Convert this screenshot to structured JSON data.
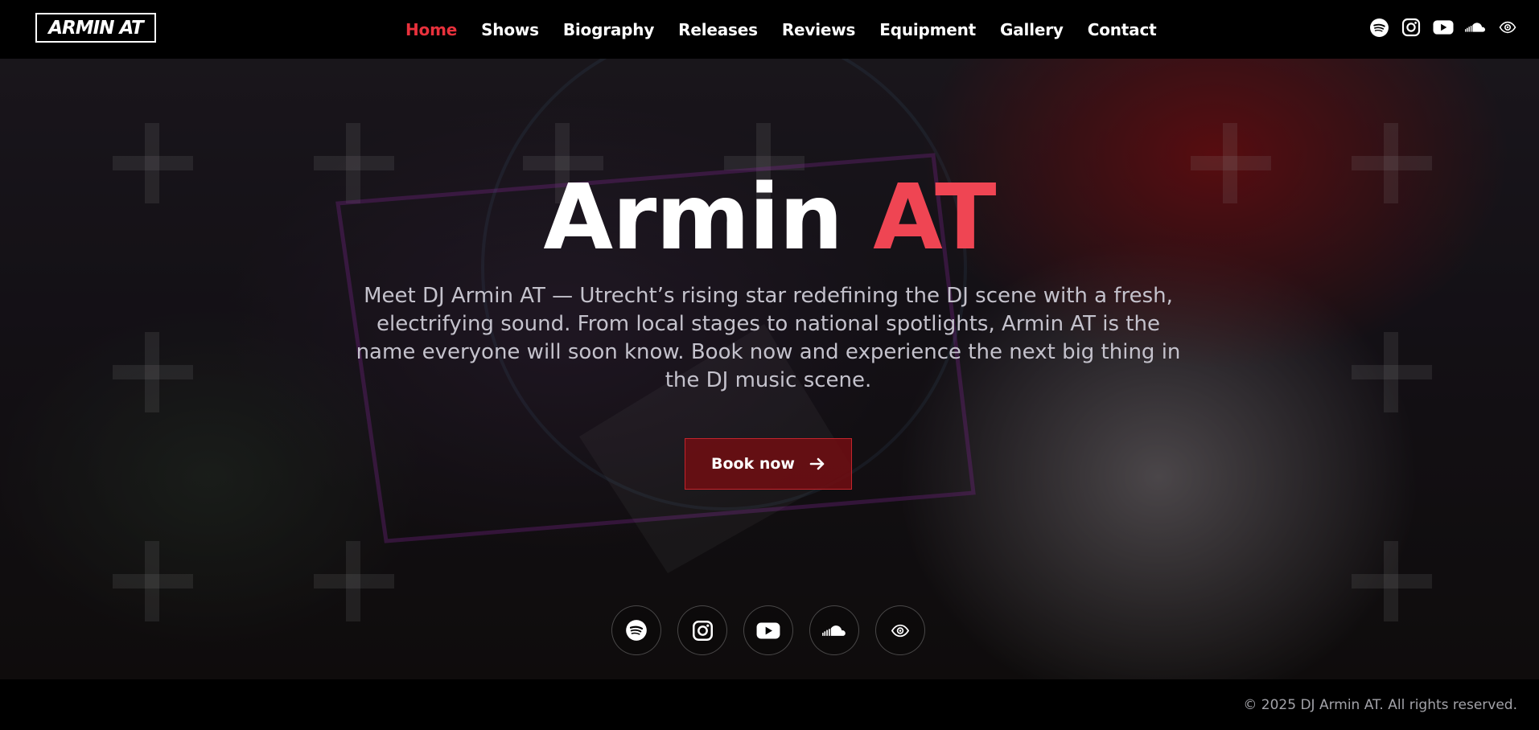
{
  "brand": {
    "logo_text": "ARMIN AT"
  },
  "nav": {
    "items": [
      {
        "label": "Home",
        "active": true
      },
      {
        "label": "Shows",
        "active": false
      },
      {
        "label": "Biography",
        "active": false
      },
      {
        "label": "Releases",
        "active": false
      },
      {
        "label": "Reviews",
        "active": false
      },
      {
        "label": "Equipment",
        "active": false
      },
      {
        "label": "Gallery",
        "active": false
      },
      {
        "label": "Contact",
        "active": false
      }
    ],
    "social_icons": [
      "spotify-icon",
      "instagram-icon",
      "youtube-icon",
      "soundcloud-icon",
      "eye-icon"
    ]
  },
  "hero": {
    "title_main": "Armin",
    "title_accent": "AT",
    "description": "Meet DJ Armin AT — Utrecht’s rising star redefining the DJ scene with a fresh, electrifying sound. From local stages to national spotlights, Armin AT is the name everyone will soon know. Book now and experience the next big thing in the DJ music scene.",
    "cta_label": "Book now",
    "social_icons": [
      "spotify-icon",
      "instagram-icon",
      "youtube-icon",
      "soundcloud-icon",
      "eye-icon"
    ]
  },
  "footer": {
    "copyright": "© 2025 DJ Armin AT. All rights reserved."
  },
  "colors": {
    "accent": "#ef4553",
    "nav_active": "#e8313c",
    "button_bg": "#6e0e12",
    "background": "#000000",
    "muted_text": "#a2a2a8"
  }
}
